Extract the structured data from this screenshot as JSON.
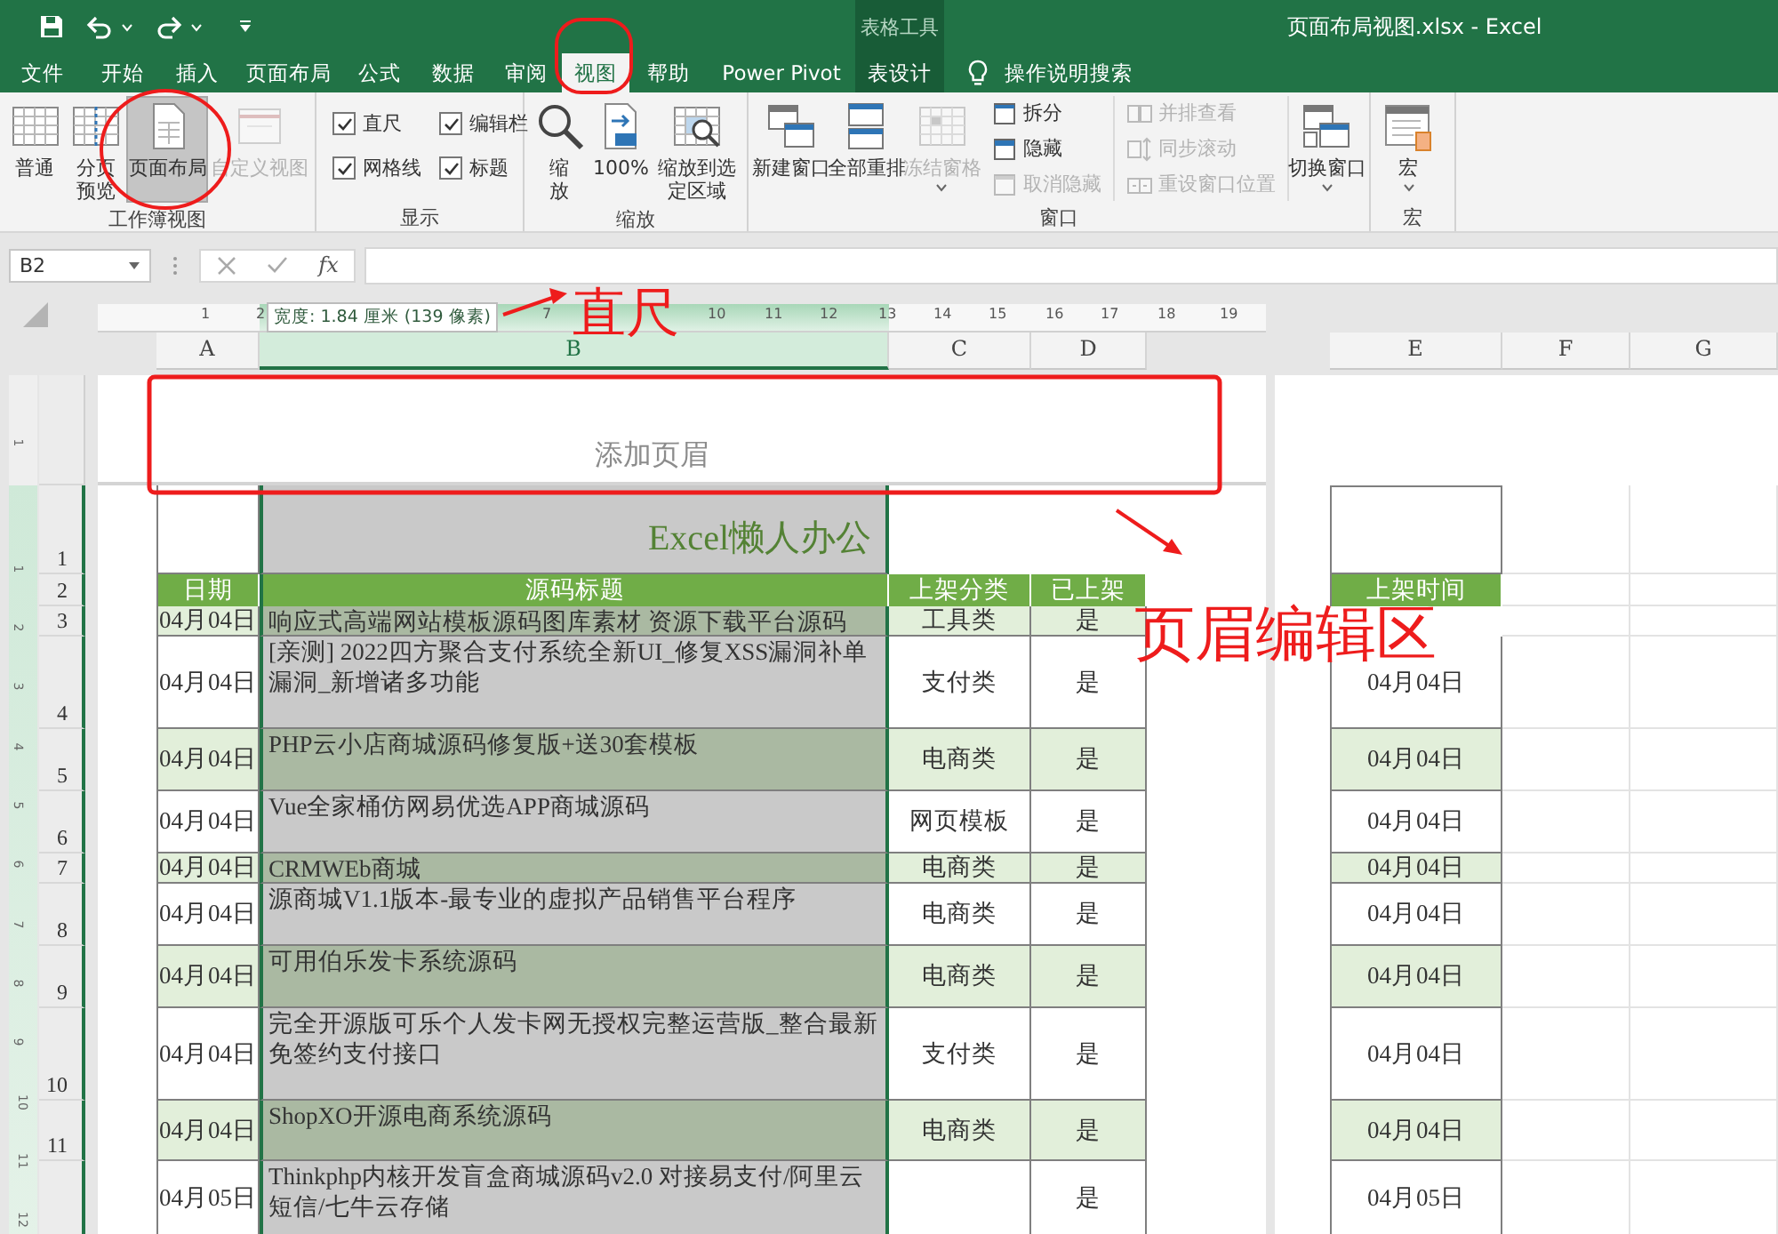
{
  "title_bar": {
    "context_group": "表格工具",
    "title": "页面布局视图.xlsx  -  Excel"
  },
  "tabs": [
    {
      "label": "文件",
      "kind": "tab",
      "selected": false
    },
    {
      "label": "开始",
      "kind": "tab",
      "selected": false
    },
    {
      "label": "插入",
      "kind": "tab",
      "selected": false
    },
    {
      "label": "页面布局",
      "kind": "tab",
      "selected": false
    },
    {
      "label": "公式",
      "kind": "tab",
      "selected": false
    },
    {
      "label": "数据",
      "kind": "tab",
      "selected": false
    },
    {
      "label": "审阅",
      "kind": "tab",
      "selected": false
    },
    {
      "label": "视图",
      "kind": "tab",
      "selected": true
    },
    {
      "label": "帮助",
      "kind": "tab",
      "selected": false
    },
    {
      "label": "Power Pivot",
      "kind": "tab",
      "selected": false
    },
    {
      "label": "表设计",
      "kind": "context",
      "selected": false
    }
  ],
  "tell_me": "操作说明搜索",
  "ribbon": [
    {
      "label": "工作簿视图",
      "items": [
        {
          "kind": "large",
          "label": "普通",
          "selected": false,
          "disabled": false,
          "caret": false
        },
        {
          "kind": "large",
          "label": "分页预览",
          "selected": false,
          "disabled": false,
          "caret": false
        },
        {
          "kind": "large",
          "label": "页面布局",
          "selected": true,
          "disabled": false,
          "caret": false
        },
        {
          "kind": "large",
          "label": "自定义视图",
          "selected": false,
          "disabled": true,
          "caret": false
        }
      ]
    },
    {
      "label": "显示",
      "items": [
        {
          "kind": "check",
          "label": "直尺",
          "checked": true
        },
        {
          "kind": "check",
          "label": "编辑栏",
          "checked": true
        },
        {
          "kind": "check",
          "label": "网格线",
          "checked": true
        },
        {
          "kind": "check",
          "label": "标题",
          "checked": true
        }
      ]
    },
    {
      "label": "缩放",
      "items": [
        {
          "kind": "large",
          "label": "缩放",
          "selected": false,
          "disabled": false,
          "caret": false
        },
        {
          "kind": "large",
          "label": "100%",
          "selected": false,
          "disabled": false,
          "caret": false
        },
        {
          "kind": "large",
          "label": "缩放到选定区域",
          "selected": false,
          "disabled": false,
          "caret": false
        }
      ]
    },
    {
      "label": "窗口",
      "items": [
        {
          "kind": "large",
          "label": "新建窗口",
          "selected": false,
          "disabled": false,
          "caret": false
        },
        {
          "kind": "large",
          "label": "全部重排",
          "selected": false,
          "disabled": false,
          "caret": false
        },
        {
          "kind": "large",
          "label": "冻结窗格",
          "selected": false,
          "disabled": true,
          "caret": true
        },
        {
          "kind": "small",
          "label": "拆分",
          "disabled": false
        },
        {
          "kind": "small",
          "label": "隐藏",
          "disabled": false
        },
        {
          "kind": "small",
          "label": "取消隐藏",
          "disabled": true
        },
        {
          "kind": "small",
          "label": "并排查看",
          "disabled": true
        },
        {
          "kind": "small",
          "label": "同步滚动",
          "disabled": true
        },
        {
          "kind": "small",
          "label": "重设窗口位置",
          "disabled": true
        },
        {
          "kind": "large",
          "label": "切换窗口",
          "selected": false,
          "disabled": false,
          "caret": true
        }
      ]
    },
    {
      "label": "宏",
      "items": [
        {
          "kind": "large",
          "label": "宏",
          "selected": false,
          "disabled": false,
          "caret": true
        }
      ]
    }
  ],
  "formula_bar": {
    "name_box": "B2",
    "function_label": "fx"
  },
  "ruler": {
    "labels": [
      "1",
      "2",
      "7",
      "10",
      "11",
      "12",
      "13",
      "14",
      "15",
      "16",
      "17",
      "18",
      "19"
    ],
    "tooltip": "宽度: 1.84 厘米 (139 像素)"
  },
  "vertical_ruler": [
    "1",
    "1",
    "2",
    "3",
    "4",
    "5",
    "6",
    "7",
    "8",
    "9",
    "10",
    "11",
    "12"
  ],
  "columns": [
    {
      "label": "A",
      "selected": false
    },
    {
      "label": "B",
      "selected": true
    },
    {
      "label": "C",
      "selected": false
    },
    {
      "label": "D",
      "selected": false
    },
    {
      "label": "E",
      "selected": false
    },
    {
      "label": "F",
      "selected": false
    },
    {
      "label": "G",
      "selected": false
    }
  ],
  "page_header": "添加页眉",
  "rows": [
    {
      "kind": "title",
      "row_label": "1",
      "title": "Excel懒人办公"
    },
    {
      "kind": "header",
      "row_label": "2",
      "cells": [
        "日期",
        "源码标题",
        "上架分类",
        "已上架",
        "上架时间"
      ]
    },
    {
      "kind": "data",
      "row_label": "3",
      "shaded": true,
      "date": "04月04日",
      "title": "响应式高端网站模板源码图库素材 资源下载平台源码",
      "category": "工具类",
      "listed": "是"
    },
    {
      "kind": "data",
      "row_label": "4",
      "shaded": false,
      "date": "04月04日",
      "title": "[亲测] 2022四方聚合支付系统全新UI_修复XSS漏洞补单漏洞_新增诸多功能",
      "category": "支付类",
      "listed": "是",
      "listed_time": "04月04日"
    },
    {
      "kind": "data",
      "row_label": "5",
      "shaded": true,
      "date": "04月04日",
      "title": "PHP云小店商城源码修复版+送30套模板",
      "category": "电商类",
      "listed": "是",
      "listed_time": "04月04日"
    },
    {
      "kind": "data",
      "row_label": "6",
      "shaded": false,
      "date": "04月04日",
      "title": "Vue全家桶仿网易优选APP商城源码",
      "category": "网页模板",
      "listed": "是",
      "listed_time": "04月04日"
    },
    {
      "kind": "data",
      "row_label": "7",
      "shaded": true,
      "date": "04月04日",
      "title": "CRMWEb商城",
      "category": "电商类",
      "listed": "是",
      "listed_time": "04月04日"
    },
    {
      "kind": "data",
      "row_label": "8",
      "shaded": false,
      "date": "04月04日",
      "title": "源商城V1.1版本-最专业的虚拟产品销售平台程序",
      "category": "电商类",
      "listed": "是",
      "listed_time": "04月04日"
    },
    {
      "kind": "data",
      "row_label": "9",
      "shaded": true,
      "date": "04月04日",
      "title": "可用伯乐发卡系统源码",
      "category": "电商类",
      "listed": "是",
      "listed_time": "04月04日"
    },
    {
      "kind": "data",
      "row_label": "10",
      "shaded": false,
      "date": "04月04日",
      "title": "完全开源版可乐个人发卡网无授权完整运营版_整合最新免签约支付接口",
      "category": "支付类",
      "listed": "是",
      "listed_time": "04月04日"
    },
    {
      "kind": "data",
      "row_label": "11",
      "shaded": true,
      "date": "04月04日",
      "title": "ShopXO开源电商系统源码",
      "category": "电商类",
      "listed": "是",
      "listed_time": "04月04日"
    },
    {
      "kind": "data",
      "shaded": false,
      "date": "04月05日",
      "title": "Thinkphp内核开发盲盒商城源码v2.0 对接易支付/阿里云短信/七牛云存储",
      "listed": "是",
      "listed_time": "04月05日"
    }
  ],
  "annotations": {
    "ruler_note": "直尺",
    "header_note": "页眉编辑区"
  }
}
